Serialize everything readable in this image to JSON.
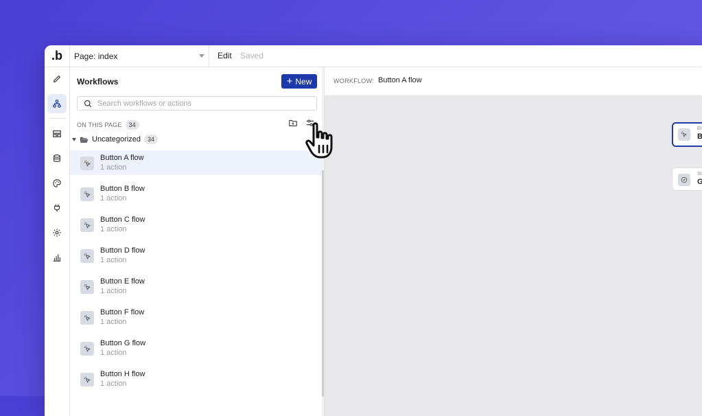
{
  "topbar": {
    "logo_text": ".b",
    "page_select": "Page: index",
    "edit_label": "Edit",
    "saved_label": "Saved"
  },
  "rail": {
    "items": [
      {
        "icon": "pencil-icon"
      },
      {
        "icon": "workflow-icon",
        "active": true
      },
      {
        "icon": "layout-icon"
      },
      {
        "icon": "database-icon"
      },
      {
        "icon": "palette-icon"
      },
      {
        "icon": "plug-icon"
      },
      {
        "icon": "gear-icon"
      },
      {
        "icon": "bar-chart-icon"
      }
    ]
  },
  "panel": {
    "title": "Workflows",
    "new_button": "New",
    "search_placeholder": "Search workflows or actions",
    "section_label": "ON THIS PAGE",
    "section_count": "34",
    "group_name": "Uncategorized",
    "group_count": "34",
    "workflows": [
      {
        "name": "Button A flow",
        "sub": "1 action",
        "selected": true
      },
      {
        "name": "Button B flow",
        "sub": "1 action"
      },
      {
        "name": "Button C flow",
        "sub": "1 action"
      },
      {
        "name": "Button D flow",
        "sub": "1 action"
      },
      {
        "name": "Button E flow",
        "sub": "1 action"
      },
      {
        "name": "Button F flow",
        "sub": "1 action"
      },
      {
        "name": "Button G flow",
        "sub": "1 action"
      },
      {
        "name": "Button H flow",
        "sub": "1 action"
      }
    ]
  },
  "workflow_header": {
    "label": "WORKFLOW:",
    "value": "Button A flow"
  },
  "canvas": {
    "trigger_node": {
      "top": "El",
      "main": "B"
    },
    "step_node": {
      "top": "St",
      "main": "G"
    }
  },
  "colors": {
    "accent": "#1d3aa8",
    "selected_row": "#edf2fd",
    "canvas_bg": "#e8e8ea",
    "background_gradient_start": "#4a3fd6"
  }
}
